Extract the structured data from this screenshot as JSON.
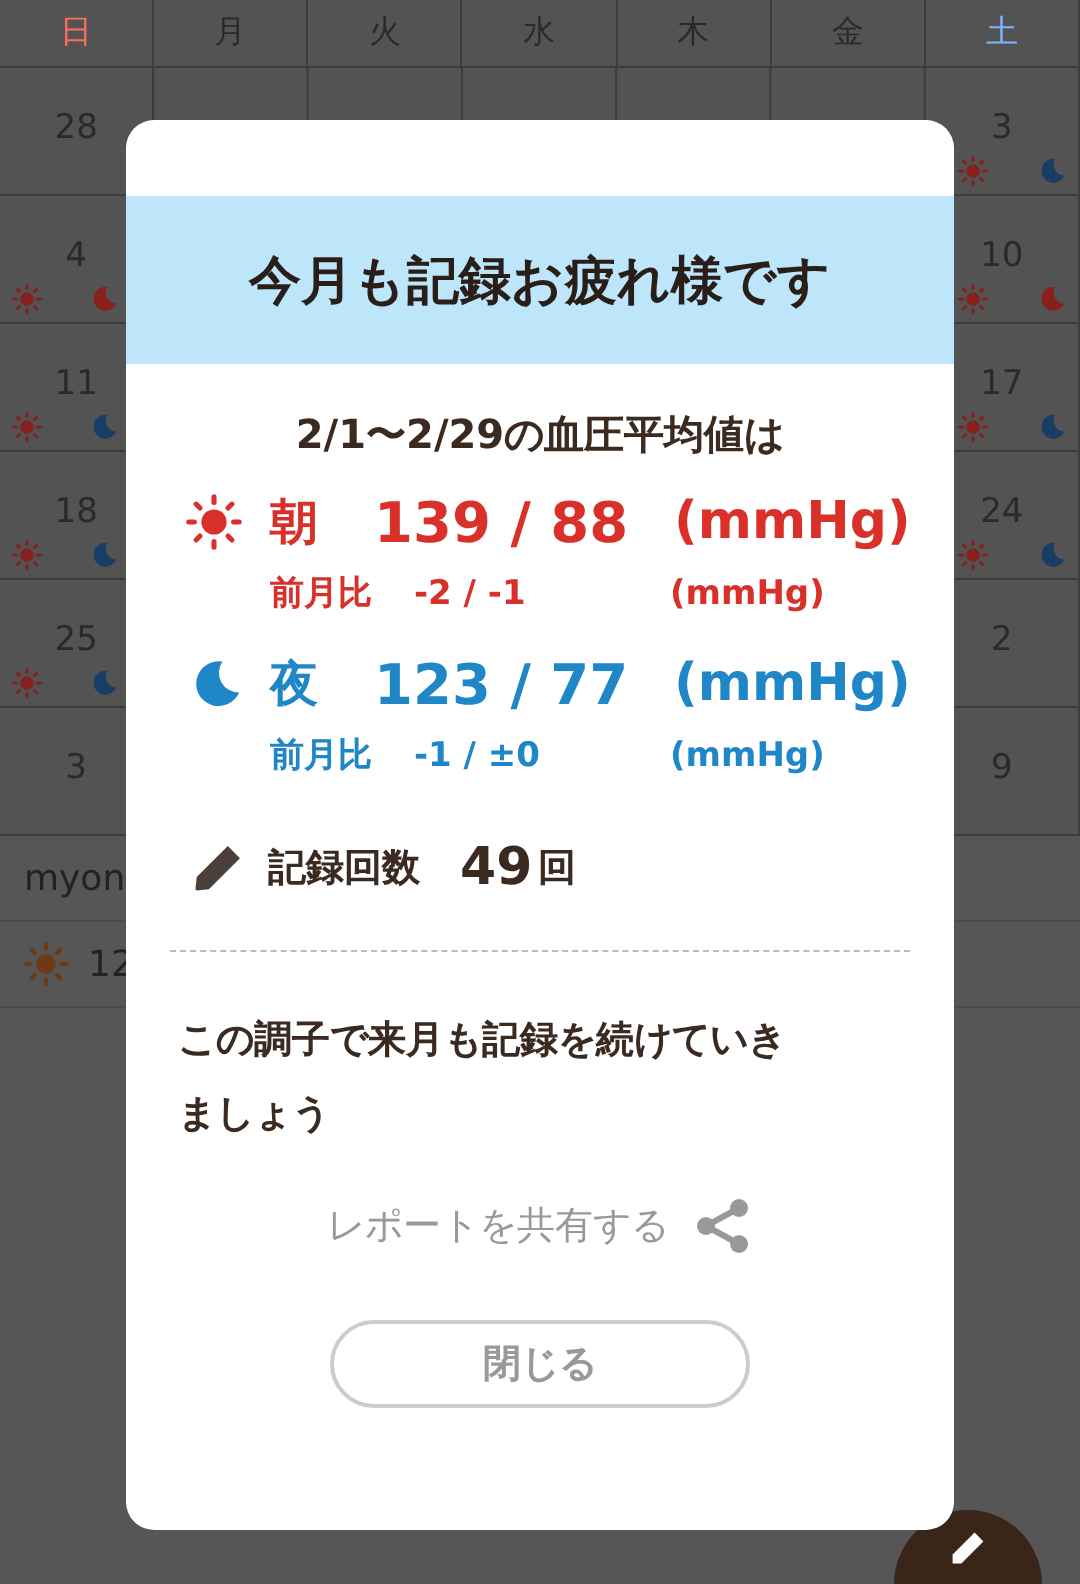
{
  "calendar": {
    "weekdays": [
      {
        "label": "日",
        "kind": "sunday"
      },
      {
        "label": "月",
        "kind": "weekday"
      },
      {
        "label": "火",
        "kind": "weekday"
      },
      {
        "label": "水",
        "kind": "weekday"
      },
      {
        "label": "木",
        "kind": "weekday"
      },
      {
        "label": "金",
        "kind": "weekday"
      },
      {
        "label": "土",
        "kind": "saturday"
      }
    ],
    "weeks": [
      {
        "first": {
          "day": "28"
        },
        "last": {
          "day": "3",
          "marks": [
            {
              "kind": "sun",
              "color": "#8a201b"
            },
            {
              "kind": "moon",
              "color": "#173f66"
            }
          ]
        }
      },
      {
        "first": {
          "day": "4",
          "marks": [
            {
              "kind": "sun",
              "color": "#8a201b"
            },
            {
              "kind": "moon",
              "color": "#8a201b"
            }
          ]
        },
        "last": {
          "day": "10",
          "marks": [
            {
              "kind": "sun",
              "color": "#8a201b"
            },
            {
              "kind": "moon",
              "color": "#8a201b"
            }
          ]
        }
      },
      {
        "first": {
          "day": "11",
          "marks": [
            {
              "kind": "sun",
              "color": "#8a201b"
            },
            {
              "kind": "moon",
              "color": "#173f66"
            }
          ]
        },
        "last": {
          "day": "17",
          "marks": [
            {
              "kind": "sun",
              "color": "#8a201b"
            },
            {
              "kind": "moon",
              "color": "#173f66"
            }
          ]
        }
      },
      {
        "first": {
          "day": "18",
          "marks": [
            {
              "kind": "sun",
              "color": "#8a201b"
            },
            {
              "kind": "moon",
              "color": "#173f66"
            }
          ]
        },
        "last": {
          "day": "24",
          "marks": [
            {
              "kind": "sun",
              "color": "#8a201b"
            },
            {
              "kind": "moon",
              "color": "#173f66"
            }
          ]
        }
      },
      {
        "first": {
          "day": "25",
          "marks": [
            {
              "kind": "sun",
              "color": "#8a201b"
            },
            {
              "kind": "moon",
              "color": "#173f66"
            }
          ]
        },
        "last": {
          "day": "2"
        }
      },
      {
        "first": {
          "day": "3"
        },
        "last": {
          "day": "9"
        }
      }
    ]
  },
  "list": {
    "name": "myon",
    "reading": "12"
  },
  "dialog": {
    "title": "今月も記録お疲れ様です",
    "period": "2/1〜2/29の血圧平均値は",
    "readings": [
      {
        "kind": "morning",
        "label": "朝",
        "value": "139 / 88",
        "unit": "(mmHg)",
        "diff_label": "前月比",
        "diff": "-2 / -1",
        "diff_unit": "(mmHg)"
      },
      {
        "kind": "night",
        "label": "夜",
        "value": "123 / 77",
        "unit": "(mmHg)",
        "diff_label": "前月比",
        "diff": "-1 / ±0",
        "diff_unit": "(mmHg)"
      }
    ],
    "count": {
      "label": "記録回数",
      "value": "49",
      "suffix": "回"
    },
    "message": "この調子で来月も記録を続けていきましょう",
    "share": "レポートを共有する",
    "close": "閉じる"
  }
}
